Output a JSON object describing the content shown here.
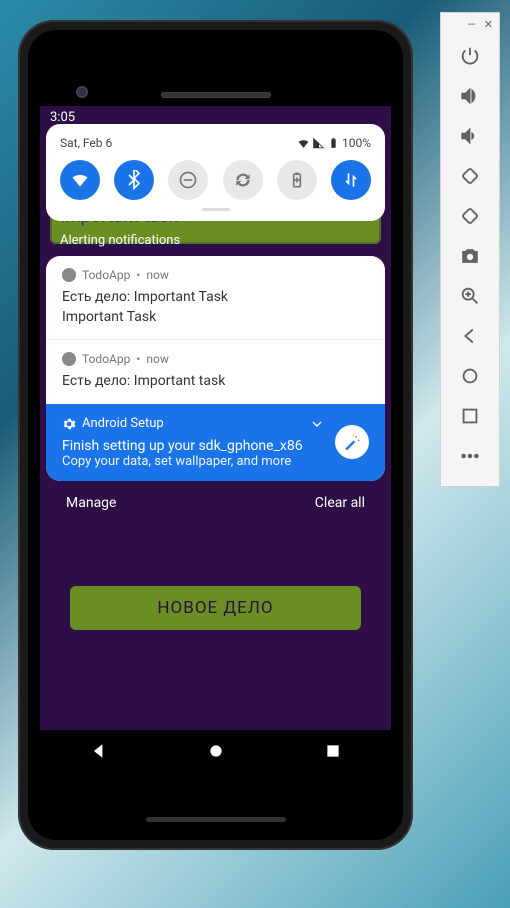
{
  "emulator": {
    "buttons": [
      "power",
      "volume-up",
      "volume-down",
      "rotate-left",
      "rotate-right",
      "camera",
      "zoom",
      "back",
      "home",
      "overview",
      "more"
    ]
  },
  "status": {
    "clock": "3:05",
    "date": "Sat, Feb 6",
    "battery": "100%"
  },
  "qs": {
    "tiles": [
      {
        "name": "wifi",
        "active": true
      },
      {
        "name": "bluetooth",
        "active": true
      },
      {
        "name": "dnd",
        "active": false
      },
      {
        "name": "auto-rotate",
        "active": false
      },
      {
        "name": "battery-saver",
        "active": false
      },
      {
        "name": "mobile-data",
        "active": true
      }
    ]
  },
  "shade": {
    "alerting_header": "Alerting notifications",
    "notifications": [
      {
        "app": "TodoApp",
        "time": "now",
        "title": "Есть дело: Important Task",
        "body": "Important Task"
      },
      {
        "app": "TodoApp",
        "time": "now",
        "title": "Есть дело: Important task",
        "body": ""
      }
    ],
    "setup": {
      "app": "Android Setup",
      "title": "Finish setting up your sdk_gphone_x86",
      "body": "Copy your data, set wallpaper, and more"
    },
    "manage": "Manage",
    "clear": "Clear all"
  },
  "app": {
    "visible_task": "Important task",
    "button": "НОВОЕ ДЕЛО"
  }
}
